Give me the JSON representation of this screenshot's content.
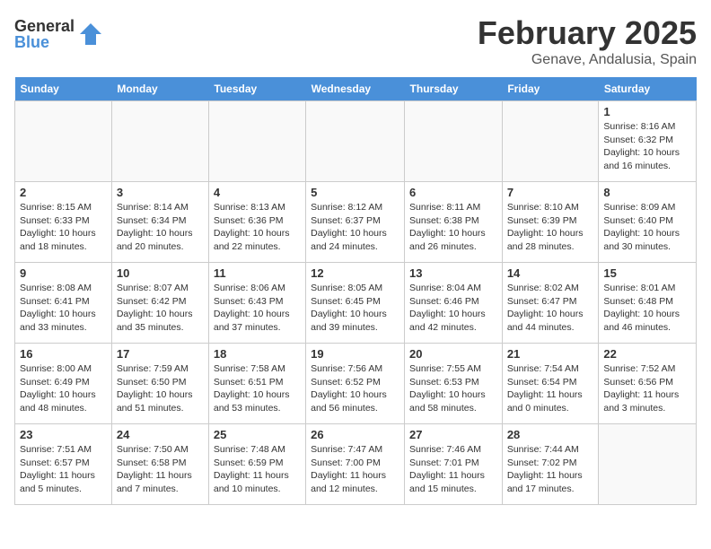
{
  "header": {
    "logo_general": "General",
    "logo_blue": "Blue",
    "month_title": "February 2025",
    "location": "Genave, Andalusia, Spain"
  },
  "days_of_week": [
    "Sunday",
    "Monday",
    "Tuesday",
    "Wednesday",
    "Thursday",
    "Friday",
    "Saturday"
  ],
  "weeks": [
    [
      {
        "day": "",
        "info": ""
      },
      {
        "day": "",
        "info": ""
      },
      {
        "day": "",
        "info": ""
      },
      {
        "day": "",
        "info": ""
      },
      {
        "day": "",
        "info": ""
      },
      {
        "day": "",
        "info": ""
      },
      {
        "day": "1",
        "info": "Sunrise: 8:16 AM\nSunset: 6:32 PM\nDaylight: 10 hours\nand 16 minutes."
      }
    ],
    [
      {
        "day": "2",
        "info": "Sunrise: 8:15 AM\nSunset: 6:33 PM\nDaylight: 10 hours\nand 18 minutes."
      },
      {
        "day": "3",
        "info": "Sunrise: 8:14 AM\nSunset: 6:34 PM\nDaylight: 10 hours\nand 20 minutes."
      },
      {
        "day": "4",
        "info": "Sunrise: 8:13 AM\nSunset: 6:36 PM\nDaylight: 10 hours\nand 22 minutes."
      },
      {
        "day": "5",
        "info": "Sunrise: 8:12 AM\nSunset: 6:37 PM\nDaylight: 10 hours\nand 24 minutes."
      },
      {
        "day": "6",
        "info": "Sunrise: 8:11 AM\nSunset: 6:38 PM\nDaylight: 10 hours\nand 26 minutes."
      },
      {
        "day": "7",
        "info": "Sunrise: 8:10 AM\nSunset: 6:39 PM\nDaylight: 10 hours\nand 28 minutes."
      },
      {
        "day": "8",
        "info": "Sunrise: 8:09 AM\nSunset: 6:40 PM\nDaylight: 10 hours\nand 30 minutes."
      }
    ],
    [
      {
        "day": "9",
        "info": "Sunrise: 8:08 AM\nSunset: 6:41 PM\nDaylight: 10 hours\nand 33 minutes."
      },
      {
        "day": "10",
        "info": "Sunrise: 8:07 AM\nSunset: 6:42 PM\nDaylight: 10 hours\nand 35 minutes."
      },
      {
        "day": "11",
        "info": "Sunrise: 8:06 AM\nSunset: 6:43 PM\nDaylight: 10 hours\nand 37 minutes."
      },
      {
        "day": "12",
        "info": "Sunrise: 8:05 AM\nSunset: 6:45 PM\nDaylight: 10 hours\nand 39 minutes."
      },
      {
        "day": "13",
        "info": "Sunrise: 8:04 AM\nSunset: 6:46 PM\nDaylight: 10 hours\nand 42 minutes."
      },
      {
        "day": "14",
        "info": "Sunrise: 8:02 AM\nSunset: 6:47 PM\nDaylight: 10 hours\nand 44 minutes."
      },
      {
        "day": "15",
        "info": "Sunrise: 8:01 AM\nSunset: 6:48 PM\nDaylight: 10 hours\nand 46 minutes."
      }
    ],
    [
      {
        "day": "16",
        "info": "Sunrise: 8:00 AM\nSunset: 6:49 PM\nDaylight: 10 hours\nand 48 minutes."
      },
      {
        "day": "17",
        "info": "Sunrise: 7:59 AM\nSunset: 6:50 PM\nDaylight: 10 hours\nand 51 minutes."
      },
      {
        "day": "18",
        "info": "Sunrise: 7:58 AM\nSunset: 6:51 PM\nDaylight: 10 hours\nand 53 minutes."
      },
      {
        "day": "19",
        "info": "Sunrise: 7:56 AM\nSunset: 6:52 PM\nDaylight: 10 hours\nand 56 minutes."
      },
      {
        "day": "20",
        "info": "Sunrise: 7:55 AM\nSunset: 6:53 PM\nDaylight: 10 hours\nand 58 minutes."
      },
      {
        "day": "21",
        "info": "Sunrise: 7:54 AM\nSunset: 6:54 PM\nDaylight: 11 hours\nand 0 minutes."
      },
      {
        "day": "22",
        "info": "Sunrise: 7:52 AM\nSunset: 6:56 PM\nDaylight: 11 hours\nand 3 minutes."
      }
    ],
    [
      {
        "day": "23",
        "info": "Sunrise: 7:51 AM\nSunset: 6:57 PM\nDaylight: 11 hours\nand 5 minutes."
      },
      {
        "day": "24",
        "info": "Sunrise: 7:50 AM\nSunset: 6:58 PM\nDaylight: 11 hours\nand 7 minutes."
      },
      {
        "day": "25",
        "info": "Sunrise: 7:48 AM\nSunset: 6:59 PM\nDaylight: 11 hours\nand 10 minutes."
      },
      {
        "day": "26",
        "info": "Sunrise: 7:47 AM\nSunset: 7:00 PM\nDaylight: 11 hours\nand 12 minutes."
      },
      {
        "day": "27",
        "info": "Sunrise: 7:46 AM\nSunset: 7:01 PM\nDaylight: 11 hours\nand 15 minutes."
      },
      {
        "day": "28",
        "info": "Sunrise: 7:44 AM\nSunset: 7:02 PM\nDaylight: 11 hours\nand 17 minutes."
      },
      {
        "day": "",
        "info": ""
      }
    ]
  ]
}
